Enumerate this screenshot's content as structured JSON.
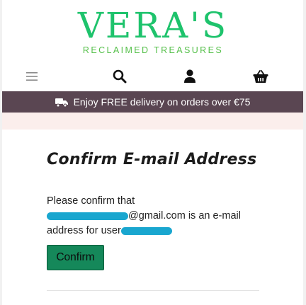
{
  "header": {
    "logo_title": "VERA'S",
    "logo_subtitle": "RECLAIMED TREASURES",
    "icons": {
      "menu": "hamburger-menu-icon",
      "search": "search-icon",
      "account": "user-icon",
      "cart": "basket-icon"
    }
  },
  "banner": {
    "icon": "truck-icon",
    "text": "Enjoy FREE delivery on orders over €75"
  },
  "main": {
    "heading": "Confirm E-mail Address",
    "message_prefix": "Please confirm that",
    "email_domain": "@gmail.com",
    "message_middle": " is an e-mail address for user",
    "confirm_label": "Confirm"
  },
  "colors": {
    "brand_green": "#1ec36c",
    "subtitle_green": "#55c04a",
    "banner_bg": "#5a4652",
    "button_bg": "#15885a",
    "redaction": "#19a6cf"
  }
}
